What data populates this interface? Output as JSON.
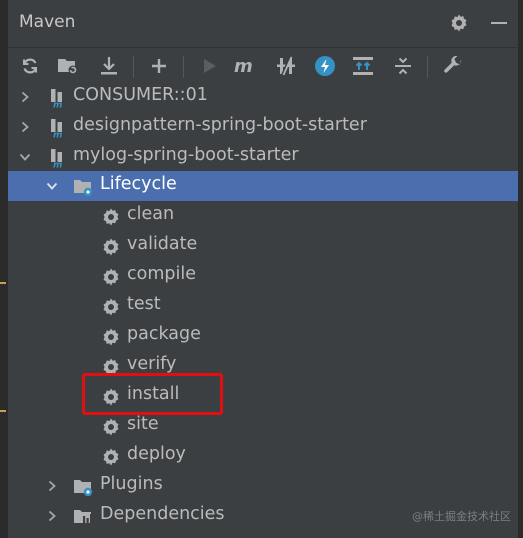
{
  "panel": {
    "title": "Maven"
  },
  "header_icons": [
    "gear-icon",
    "minimize-icon"
  ],
  "toolbar": {
    "buttons": [
      "reload-all-maven-projects",
      "generate-sources-and-update-folders",
      "download-sources",
      "add-maven-projects",
      "run-maven-build",
      "execute-maven-goal",
      "toggle-offline-mode",
      "toggle-skip-tests",
      "show-dependencies",
      "collapse-all",
      "maven-settings"
    ]
  },
  "tree": {
    "items": [
      {
        "label": "CONSUMER::01",
        "level": 0,
        "expanded": false,
        "icon": "maven-module-icon"
      },
      {
        "label": "designpattern-spring-boot-starter",
        "level": 0,
        "expanded": false,
        "icon": "maven-module-icon"
      },
      {
        "label": "mylog-spring-boot-starter",
        "level": 0,
        "expanded": true,
        "icon": "maven-module-icon"
      },
      {
        "label": "Lifecycle",
        "level": 1,
        "expanded": true,
        "selected": true,
        "icon": "folder-gear-icon"
      },
      {
        "label": "clean",
        "level": 2,
        "icon": "gear-icon"
      },
      {
        "label": "validate",
        "level": 2,
        "icon": "gear-icon"
      },
      {
        "label": "compile",
        "level": 2,
        "icon": "gear-icon"
      },
      {
        "label": "test",
        "level": 2,
        "icon": "gear-icon"
      },
      {
        "label": "package",
        "level": 2,
        "icon": "gear-icon"
      },
      {
        "label": "verify",
        "level": 2,
        "icon": "gear-icon"
      },
      {
        "label": "install",
        "level": 2,
        "icon": "gear-icon",
        "highlighted": true
      },
      {
        "label": "site",
        "level": 2,
        "icon": "gear-icon"
      },
      {
        "label": "deploy",
        "level": 2,
        "icon": "gear-icon"
      },
      {
        "label": "Plugins",
        "level": 1,
        "expanded": false,
        "icon": "folder-gear-icon"
      },
      {
        "label": "Dependencies",
        "level": 1,
        "expanded": false,
        "icon": "dependencies-icon"
      }
    ]
  },
  "watermark": "@稀土掘金技术社区",
  "colors": {
    "background": "#3c3f41",
    "selection": "#4b6eaf",
    "highlight_box": "#e01010",
    "text": "#bbbbbb"
  }
}
